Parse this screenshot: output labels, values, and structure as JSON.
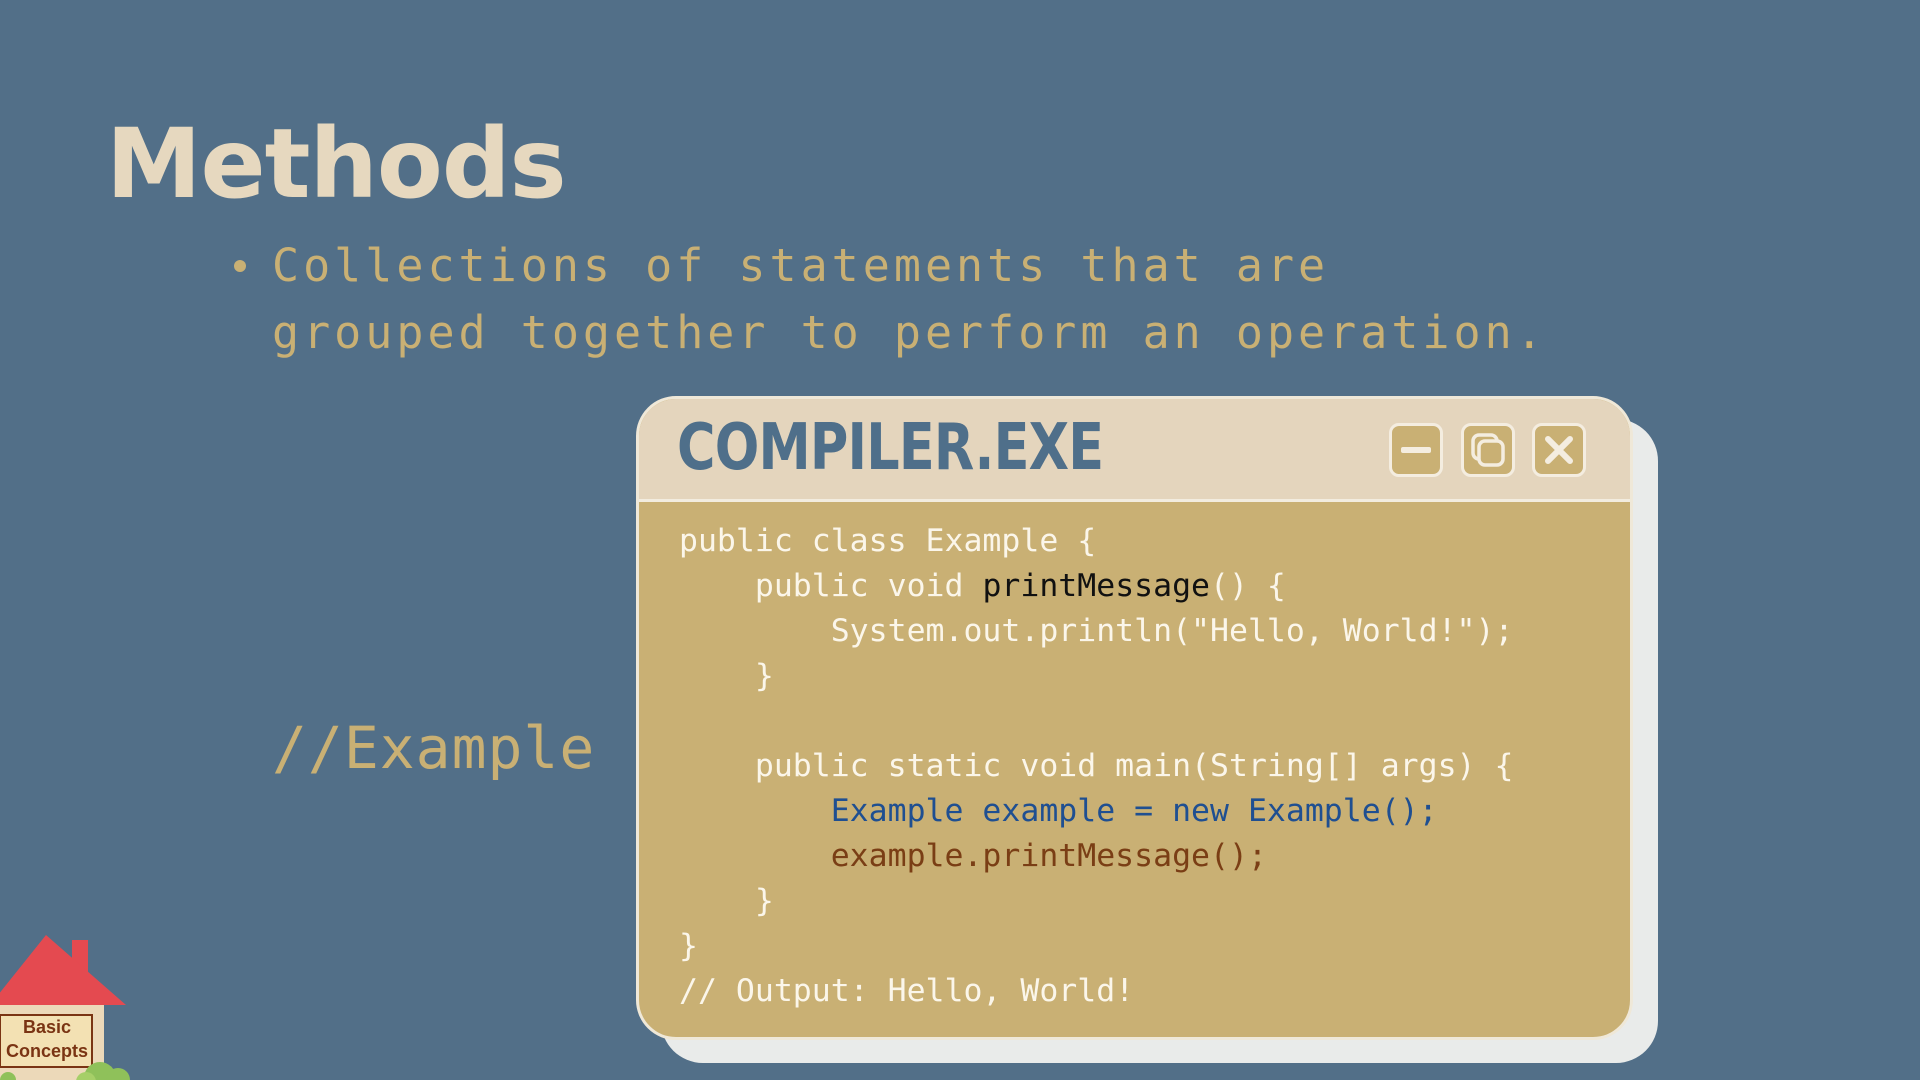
{
  "slide": {
    "title": "Methods",
    "bullets": [
      "Collections of statements that are grouped together to perform an operation."
    ],
    "example_label": "//Example"
  },
  "window": {
    "title": "COMPILER.EXE",
    "buttons": [
      {
        "name": "minimize",
        "icon": "minimize-icon"
      },
      {
        "name": "maximize",
        "icon": "restore-icon"
      },
      {
        "name": "close",
        "icon": "close-icon"
      }
    ],
    "code": {
      "line1": "public class Example {",
      "line2_prefix": "    public void ",
      "line2_method": "printMessage",
      "line2_suffix": "() {",
      "line3": "        System.out.println(\"Hello, World!\");",
      "line4": "    }",
      "line5": "",
      "line6": "    public static void main(String[] args) {",
      "line7": "        Example example = new Example();",
      "line8": "        example.printMessage();",
      "line9": "    }",
      "line10": "}",
      "line11": "// Output: Hello, World!"
    }
  },
  "corner_badge": {
    "line1": "Basic",
    "line2": "Concepts"
  },
  "colors": {
    "background": "#526f88",
    "title": "#e6d8bf",
    "accent": "#c9b074",
    "window_titlebar": "#e4d5bd",
    "window_title_text": "#4f6f8a",
    "code_text": "#fbf6ea",
    "code_blue": "#1f4f91",
    "code_brown": "#7a3e15"
  }
}
